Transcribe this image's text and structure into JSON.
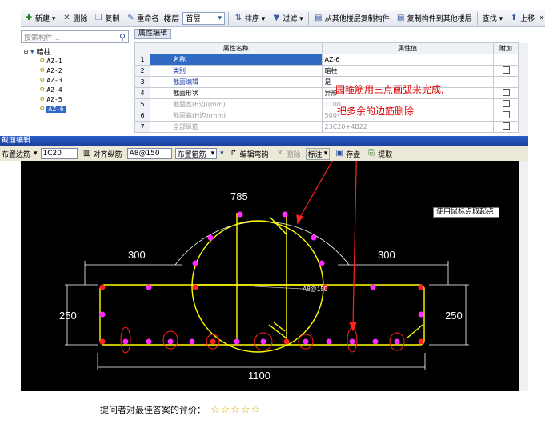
{
  "toolbar": {
    "items": [
      {
        "icon": "new-icon",
        "label": "新建 ▾"
      },
      {
        "icon": "delete-icon",
        "label": "删除"
      },
      {
        "icon": "copy-icon",
        "label": "复制"
      },
      {
        "icon": "rename-icon",
        "label": "重命名"
      }
    ],
    "floor_label": "楼层",
    "floor_value": "首层",
    "sort_label": "排序 ▾",
    "filter_label": "过滤 ▾",
    "copy_from_label": "从其他楼层复制构件",
    "copy_to_label": "复制构件到其他楼层",
    "find_label": "查找 ▾",
    "up_label": "上移",
    "more": "»"
  },
  "left_panel": {
    "search_placeholder": "搜索构件...",
    "root": "暗柱",
    "items": [
      "AZ-1",
      "AZ-2",
      "AZ-3",
      "AZ-4",
      "AZ-5",
      "AZ-6"
    ],
    "selected": "AZ-6"
  },
  "props": {
    "tab": "属性编辑",
    "headers": {
      "name": "属性名称",
      "value": "属性值",
      "extra": "附加"
    },
    "rows": [
      {
        "n": "1",
        "name": "名称",
        "value": "AZ-6",
        "style": "blue",
        "cb": false
      },
      {
        "n": "2",
        "name": "类别",
        "value": "暗柱",
        "style": "blue",
        "cb": true
      },
      {
        "n": "3",
        "name": "截面编辑",
        "value": "是",
        "style": "blue",
        "cb": false
      },
      {
        "n": "4",
        "name": "截面形状",
        "value": "异形",
        "style": "",
        "cb": true
      },
      {
        "n": "5",
        "name": "截面宽(B边)(mm)",
        "value": "1100",
        "style": "gray",
        "cb": true
      },
      {
        "n": "6",
        "name": "截面高(H边)(mm)",
        "value": "500",
        "style": "gray",
        "cb": true
      },
      {
        "n": "7",
        "name": "全部纵筋",
        "value": "23C20+4B22",
        "style": "gray",
        "cb": true
      }
    ]
  },
  "editor": {
    "title": "截面编辑",
    "edge_rebar_label": "布置边筋",
    "edge_rebar_value": "1C20",
    "align_label": "对齐纵筋",
    "stirrup_value": "A8@150",
    "place_stirrup_label": "布置箍筋",
    "edit_hook_label": "编辑弯钩",
    "delete_label": "删除",
    "dim_label": "标注",
    "save_label": "存盘",
    "extract_label": "提取"
  },
  "drawing": {
    "dim_785": "785",
    "dim_300_left": "300",
    "dim_300_right": "300",
    "dim_250_left": "250",
    "dim_250_right": "250",
    "dim_1100": "1100",
    "stirrup_label": "A8@150",
    "tooltip": "使用鼠标点取起点."
  },
  "annotations": {
    "note1": "园箍筋用三点画弧来完成,",
    "note2": "把多余的边筋删除"
  },
  "footer": {
    "rating_label": "提问者对最佳答案的评价：",
    "stars": "☆☆☆☆☆"
  },
  "colors": {
    "canvas_bg": "#000000",
    "outline": "#ffff00",
    "rebar_magenta": "#ff2bff",
    "rebar_red": "#ff2020",
    "dims": "#ffffff",
    "annotation": "#e00000"
  }
}
